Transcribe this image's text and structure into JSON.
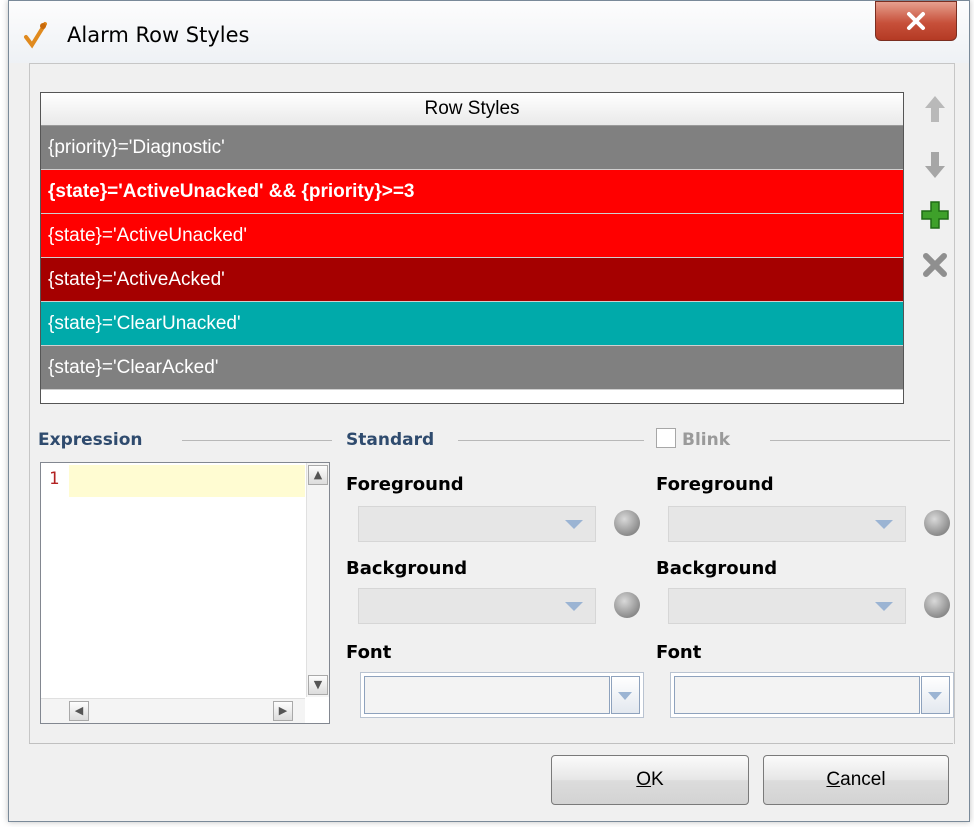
{
  "window": {
    "title": "Alarm Row Styles",
    "icon": "wrench-edit-icon"
  },
  "table": {
    "header": "Row Styles",
    "rows": [
      {
        "expression": "{priority}='Diagnostic'",
        "background": "#808080",
        "bold": false
      },
      {
        "expression": "{state}='ActiveUnacked' && {priority}>=3",
        "background": "#ff0000",
        "bold": true
      },
      {
        "expression": "{state}='ActiveUnacked'",
        "background": "#ff0000",
        "bold": false
      },
      {
        "expression": "{state}='ActiveAcked'",
        "background": "#a50000",
        "bold": false
      },
      {
        "expression": "{state}='ClearUnacked'",
        "background": "#00aaaa",
        "bold": false
      },
      {
        "expression": "{state}='ClearAcked'",
        "background": "#808080",
        "bold": false
      }
    ]
  },
  "side_buttons": [
    "move-up-icon",
    "move-down-icon",
    "add-icon",
    "delete-icon"
  ],
  "expression": {
    "label": "Expression",
    "line_number": "1",
    "value": ""
  },
  "standard": {
    "label": "Standard",
    "foreground_label": "Foreground",
    "background_label": "Background",
    "font_label": "Font"
  },
  "blink": {
    "label": "Blink",
    "checked": false,
    "foreground_label": "Foreground",
    "background_label": "Background",
    "font_label": "Font"
  },
  "buttons": {
    "ok_mnemonic": "O",
    "ok_rest": "K",
    "cancel_mnemonic": "C",
    "cancel_rest": "ancel"
  },
  "colors": {
    "section_label": "#2f4b6e",
    "add_icon": "#3ea02a"
  }
}
